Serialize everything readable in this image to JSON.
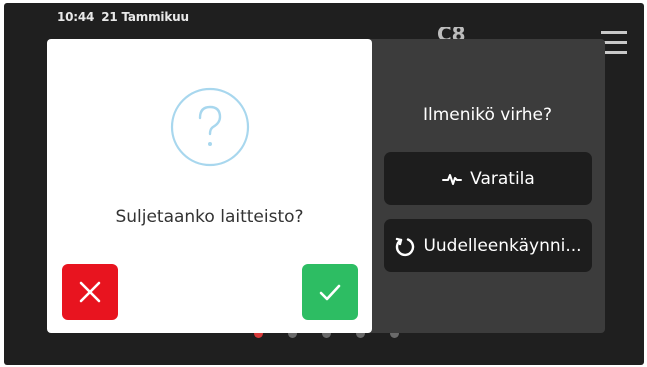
{
  "status_bar": {
    "time": "10:44",
    "date": "21 Tammikuu"
  },
  "top_bar": {
    "icon_text": "C8",
    "menu_icon": "hamburger-menu-icon"
  },
  "page_dots": {
    "count": 5,
    "active_index": 0
  },
  "right_panel": {
    "title": "Ilmenikö virhe?",
    "buttons": [
      {
        "label": "Varatila",
        "icon": "pulse-icon"
      },
      {
        "label": "Uudelleenkäynni...",
        "icon": "restart-icon"
      }
    ]
  },
  "dialog": {
    "icon": "question-icon",
    "question": "Suljetaanko laitteisto?",
    "cancel_icon": "close-icon",
    "confirm_icon": "check-icon"
  },
  "colors": {
    "screen_bg": "#1f1f1f",
    "panel_bg": "#3c3c3c",
    "button_bg": "#1d1d1d",
    "cancel": "#e8141f",
    "confirm": "#2dbd63",
    "question_ring": "#a8d7ee",
    "active_dot": "#d83a3a"
  }
}
